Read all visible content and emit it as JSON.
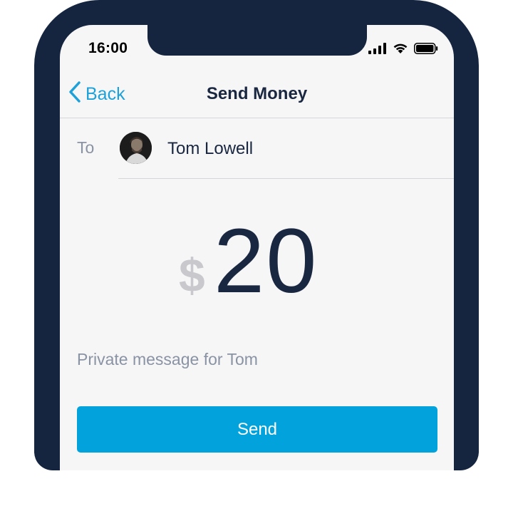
{
  "status_bar": {
    "time": "16:00",
    "icons": [
      "signal-icon",
      "wifi-icon",
      "battery-icon"
    ]
  },
  "nav": {
    "back_label": "Back",
    "title": "Send Money"
  },
  "recipient": {
    "to_label": "To",
    "name": "Tom Lowell"
  },
  "amount": {
    "currency_symbol": "$",
    "value": "20"
  },
  "message": {
    "placeholder": "Private message for Tom"
  },
  "send_button_label": "Send",
  "colors": {
    "frame": "#15253f",
    "screen_bg": "#f6f6f7",
    "accent": "#1ea1d8",
    "button": "#02a3dc",
    "text_primary": "#1a2740",
    "text_secondary": "#8a93a3"
  }
}
